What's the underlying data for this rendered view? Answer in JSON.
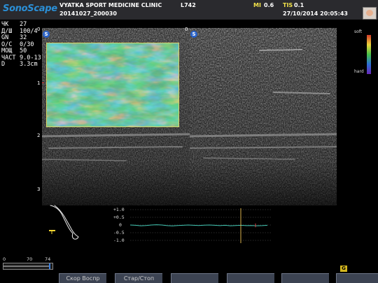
{
  "header": {
    "brand": "SonoScape",
    "clinic": "VYATKA SPORT MEDICINE CLINIC",
    "probe": "L742",
    "mi_label": "MI",
    "mi_value": "0.6",
    "tis_label": "TIS",
    "tis_value": "0.1",
    "exam_id": "20141027_200030",
    "datetime": "27/10/2014 20:05:43"
  },
  "params": [
    {
      "label": "ЧК",
      "value": "27"
    },
    {
      "label": "Д/Ш",
      "value": "100/4"
    },
    {
      "label": "GN",
      "value": "32"
    },
    {
      "label": "О/С",
      "value": "0/30"
    },
    {
      "label": "МОЩ",
      "value": "50"
    },
    {
      "label": "ЧАСТ",
      "value": "9.0-13"
    },
    {
      "label": "D",
      "value": "3.3cm"
    }
  ],
  "panels": {
    "badge": "S",
    "depth_marks": [
      "0",
      "1",
      "2",
      "3"
    ]
  },
  "colorbar": {
    "top_label": "soft",
    "bottom_label": "hard"
  },
  "trace": {
    "labels": [
      "+1.0",
      "+0.5",
      "0",
      "-0.5",
      "-1.0"
    ],
    "range": [
      -1.0,
      1.0
    ],
    "curve": [
      0.0,
      -0.02,
      -0.05,
      -0.03,
      0.0,
      0.02,
      0.0,
      -0.04,
      -0.06,
      -0.03,
      -0.02,
      0.0,
      -0.02,
      -0.03,
      -0.01,
      0.0,
      -0.02,
      -0.04,
      -0.02,
      -0.05,
      -0.03,
      -0.02,
      -0.04,
      -0.03,
      -0.05,
      -0.04,
      -0.02
    ],
    "colors": {
      "curve": "#42c7b4",
      "cursor": "#d8b04a",
      "marker": "#d94040"
    }
  },
  "slider": {
    "min": "0",
    "mid": "70",
    "max": "74",
    "fraction": 0.94
  },
  "softkeys": [
    "Скор Воспр",
    "Стар/Стоп",
    "",
    "",
    "",
    ""
  ],
  "indicator": "G"
}
